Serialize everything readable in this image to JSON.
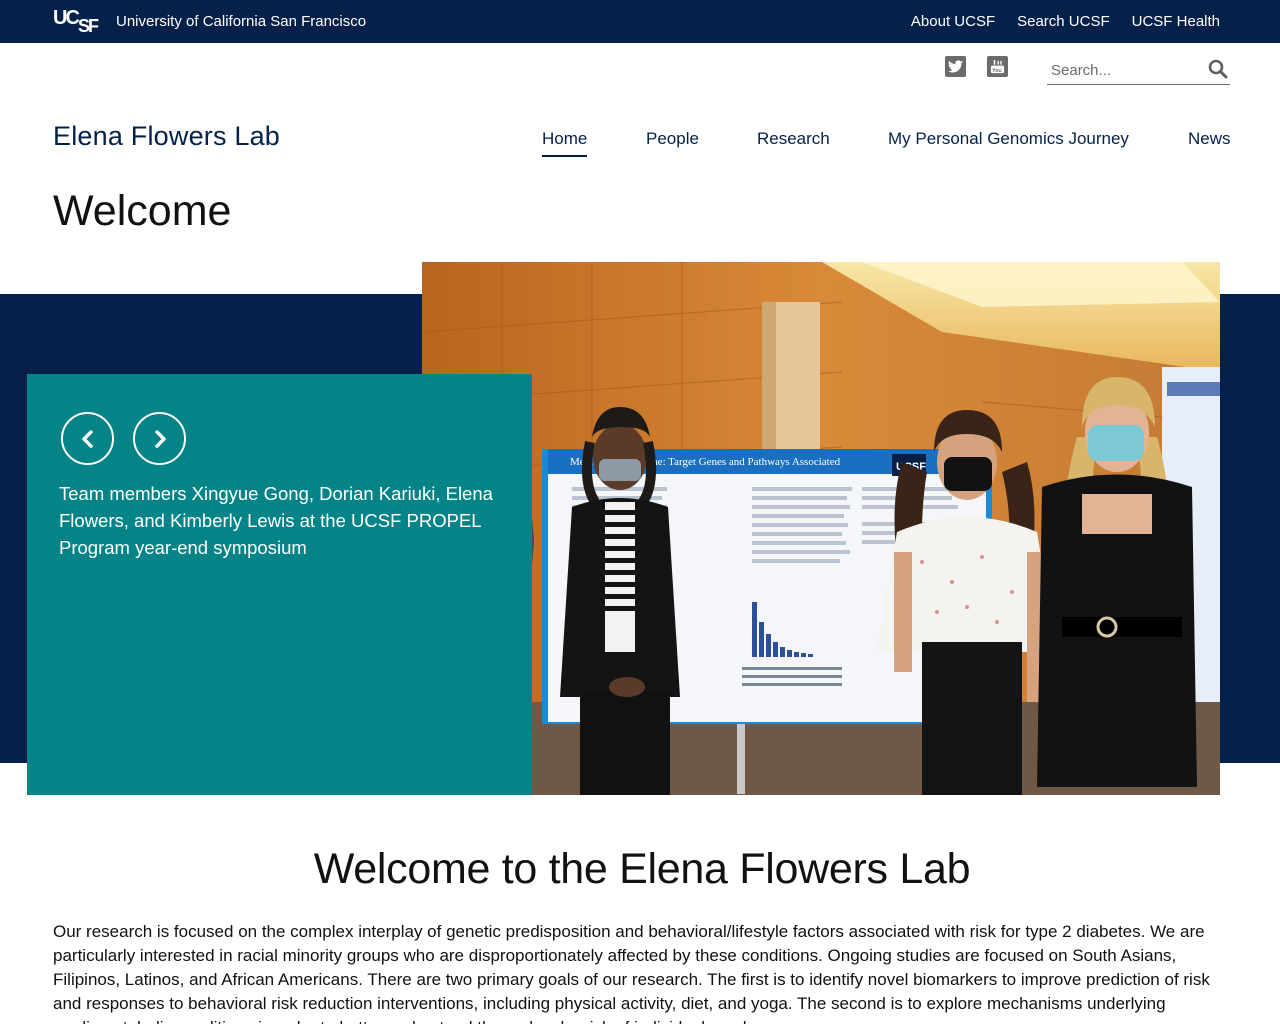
{
  "topbar": {
    "logo_text": "UCSF",
    "university": "University of California San Francisco",
    "links": [
      "About UCSF",
      "Search UCSF",
      "UCSF Health"
    ]
  },
  "header": {
    "search_placeholder": "Search...",
    "social": [
      "twitter-icon",
      "youtube-icon"
    ],
    "site_name": "Elena Flowers Lab"
  },
  "nav": {
    "items": [
      {
        "label": "Home",
        "active": true
      },
      {
        "label": "People",
        "active": false
      },
      {
        "label": "Research",
        "active": false
      },
      {
        "label": "My Personal Genomics Journey",
        "active": false
      },
      {
        "label": "News",
        "active": false
      }
    ]
  },
  "page": {
    "title": "Welcome"
  },
  "hero": {
    "caption": "Team members Xingyue Gong, Dorian Kariuki, Elena Flowers, and Kimberly Lewis at the UCSF PROPEL Program year-end symposium",
    "poster_header": "Metabolic Syndrome: Target Genes and Pathways Associated",
    "poster_logo": "UCSF"
  },
  "main": {
    "heading": "Welcome to the Elena Flowers Lab",
    "intro": "Our research is focused on the complex interplay of genetic predisposition and behavioral/lifestyle factors associated with risk for type 2 diabetes. We are particularly interested in racial minority groups who are disproportionately affected by these conditions. Ongoing studies are focused on South Asians, Filipinos, Latinos, and African Americans. There are two primary goals of our research. The first is to identify novel biomarkers to improve prediction of risk and responses to behavioral risk reduction interventions, including physical activity, diet, and yoga. The second is to explore mechanisms underlying cardiometabolic conditions in order to better understand the molecular risk of individuals and"
  },
  "colors": {
    "navy": "#052049",
    "teal": "#058488"
  }
}
